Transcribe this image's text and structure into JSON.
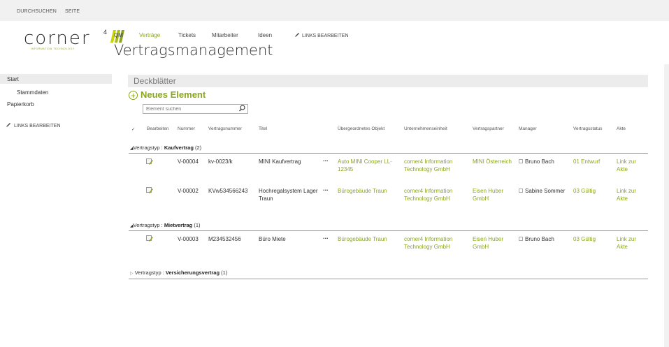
{
  "ribbon": {
    "tabs": [
      "DURCHSUCHEN",
      "SEITE"
    ]
  },
  "topnav": {
    "items": [
      "QM",
      "Verträge",
      "Tickets",
      "Mitarbeiter",
      "Ideen"
    ],
    "edit_links": "LINKS BEARBEITEN",
    "active": "Verträge"
  },
  "site": {
    "title": "Vertragsmanagement",
    "logo_text": "corner",
    "logo_sup": "4",
    "logo_sub": "INFORMATION TECHNOLOGY"
  },
  "leftnav": {
    "start": "Start",
    "sub": "Stammdaten",
    "recycle": "Papierkorb",
    "edit_links": "LINKS BEARBEITEN"
  },
  "webpart": {
    "title": "Deckblätter",
    "new_item": "Neues Element",
    "search_placeholder": "Element suchen"
  },
  "columns": [
    "Bearbeiten",
    "Nummer",
    "Vertragsnummer",
    "Titel",
    "Übergeordnetes Objekt",
    "Unternehmenseinheit",
    "Vertragspartner",
    "Manager",
    "Vertragsstatus",
    "Akte"
  ],
  "groups": [
    {
      "label": "Vertragstyp : ",
      "value": "Kaufvertrag",
      "count": "(2)",
      "expanded": true
    },
    {
      "label": "Vertragstyp : ",
      "value": "Mietvertrag",
      "count": "(1)",
      "expanded": true
    },
    {
      "label": "Vertragstyp : ",
      "value": "Versicherungsvertrag",
      "count": "(1)",
      "expanded": false
    }
  ],
  "rows": [
    {
      "nummer": "V-00004",
      "vertragsnummer": "kv-0023/k",
      "titel": "MINI Kaufvertrag",
      "objekt": "Auto MINI Cooper LL-12345",
      "einheit": "corner4 Information Technology GmbH",
      "partner": "MINI Österreich",
      "manager": "Bruno Bach",
      "status": "01 Entwurf",
      "akte": "Link zur Akte"
    },
    {
      "nummer": "V-00002",
      "vertragsnummer": "KVw534566243",
      "titel": "Hochregalsystem Lager Traun",
      "objekt": "Bürogebäude Traun",
      "einheit": "corner4 Information Technology GmbH",
      "partner": "Eisen Huber GmbH",
      "manager": "Sabine Sommer",
      "status": "03 Gültig",
      "akte": "Link zur Akte"
    },
    {
      "nummer": "V-00003",
      "vertragsnummer": "M234532456",
      "titel": "Büro Miete",
      "objekt": "Bürogebäude Traun",
      "einheit": "corner4 Information Technology GmbH",
      "partner": "Eisen Huber GmbH",
      "manager": "Bruno Bach",
      "status": "03 Gültig",
      "akte": "Link zur Akte"
    }
  ],
  "colors": {
    "accent": "#8aa61d",
    "text": "#444444",
    "band": "#ececec"
  }
}
